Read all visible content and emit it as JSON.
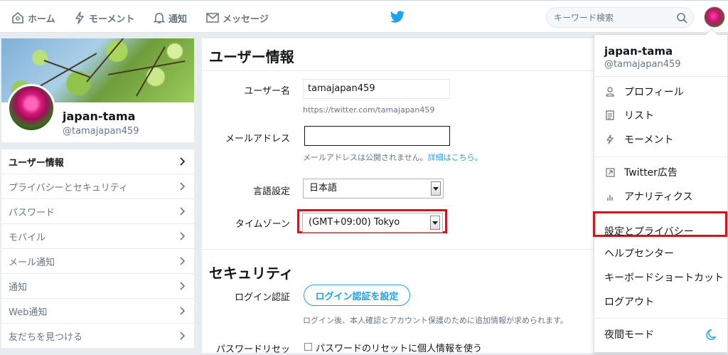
{
  "topnav": {
    "home": "ホーム",
    "moments": "モーメント",
    "notifications": "通知",
    "messages": "メッセージ",
    "search_placeholder": "キーワード検索",
    "brand_color": "#1da1f2"
  },
  "profile": {
    "name": "japan-tama",
    "handle": "@tamajapan459"
  },
  "settings_nav": {
    "items": [
      {
        "label": "ユーザー情報"
      },
      {
        "label": "プライバシーとセキュリティ"
      },
      {
        "label": "パスワード"
      },
      {
        "label": "モバイル"
      },
      {
        "label": "メール通知"
      },
      {
        "label": "通知"
      },
      {
        "label": "Web通知"
      },
      {
        "label": "友だちを見つける"
      }
    ]
  },
  "account": {
    "title": "ユーザー情報",
    "username_label": "ユーザー名",
    "username_value": "tamajapan459",
    "username_url": "https://twitter.com/tamajapan459",
    "email_label": "メールアドレス",
    "email_value": "",
    "email_hint": "メールアドレスは公開されません。",
    "email_hint_link": "詳細はこちら。",
    "language_label": "言語設定",
    "language_value": "日本語",
    "timezone_label": "タイムゾーン",
    "timezone_value": "(GMT+09:00) Tokyo"
  },
  "security": {
    "title": "セキュリティ",
    "login_verification_label": "ログイン認証",
    "login_verification_button": "ログイン認証を設定",
    "login_verification_hint": "ログイン後、本人確認とアカウント保護のために追加情報が求められます。",
    "password_reset_label": "パスワードリセッ",
    "password_reset_option": "パスワードのリセットに個人情報を使う"
  },
  "dropdown": {
    "name": "japan-tama",
    "handle": "@tamajapan459",
    "items": [
      {
        "label": "プロフィール",
        "icon": "person-icon"
      },
      {
        "label": "リスト",
        "icon": "list-icon"
      },
      {
        "label": "モーメント",
        "icon": "lightning-icon"
      }
    ],
    "items2": [
      {
        "label": "Twitter広告",
        "icon": "external-link-icon"
      },
      {
        "label": "アナリティクス",
        "icon": "bar-chart-icon"
      }
    ],
    "settings": "設定とプライバシー",
    "help": "ヘルプセンター",
    "shortcuts": "キーボードショートカット",
    "logout": "ログアウト",
    "night_mode": "夜間モード"
  },
  "highlight_color": "#d0151e"
}
